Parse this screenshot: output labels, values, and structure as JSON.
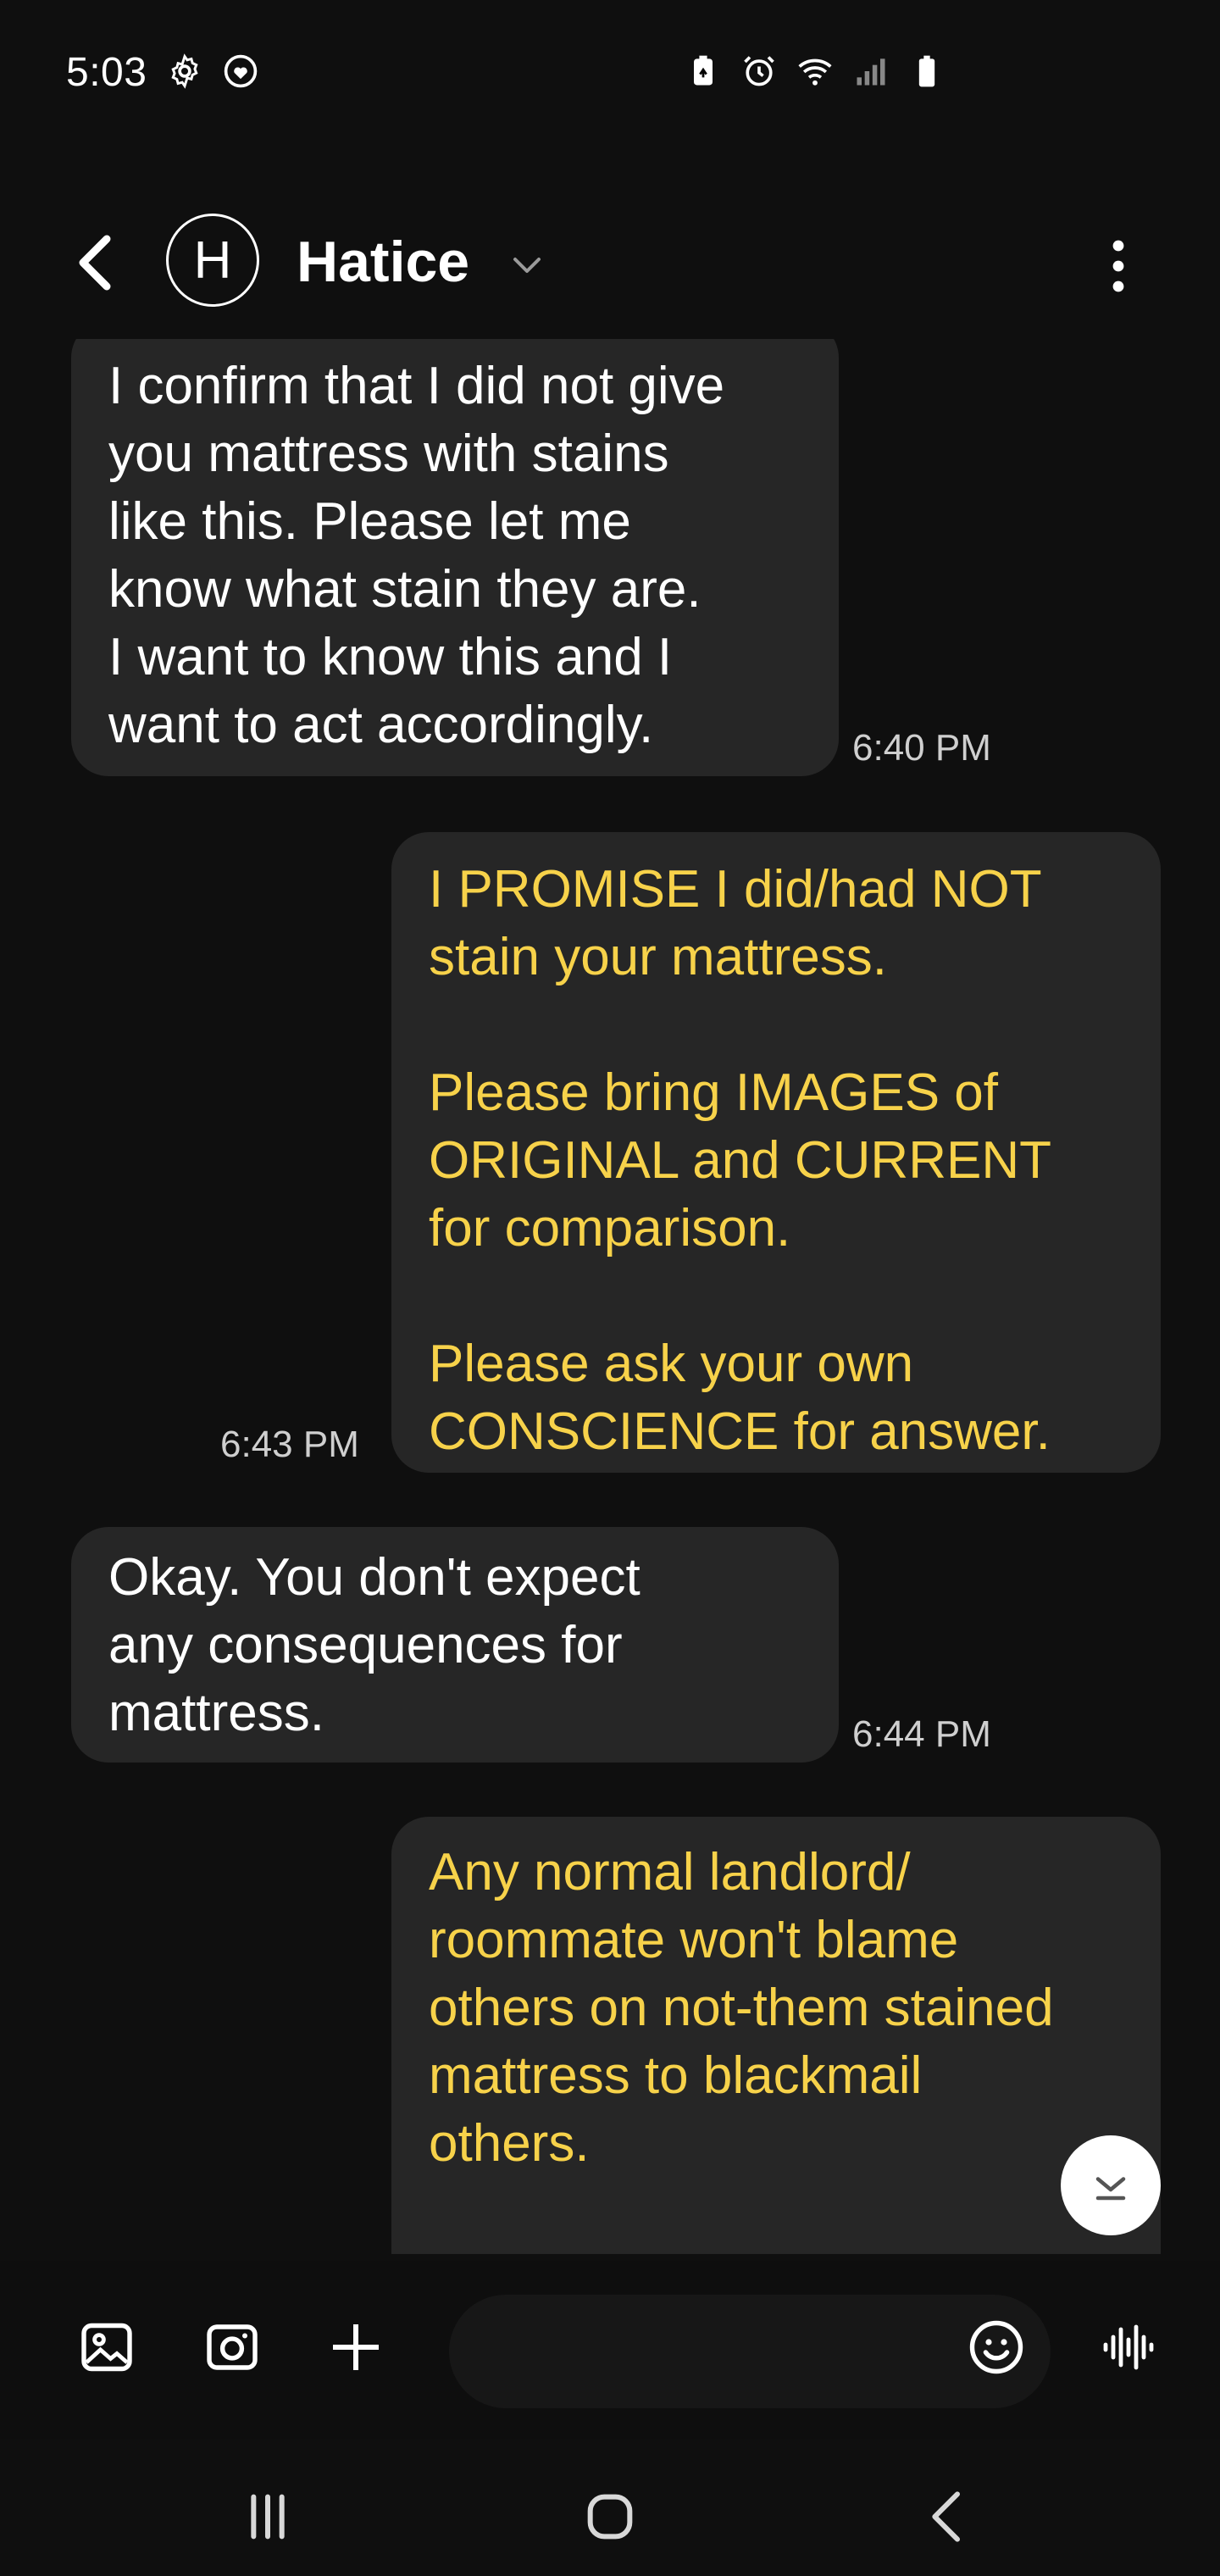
{
  "status_bar": {
    "time": "5:03",
    "left_icons": [
      "settings-gear-icon",
      "heart-status-icon"
    ],
    "right_icons": [
      "battery-saver-icon",
      "alarm-icon",
      "wifi-icon",
      "signal-icon",
      "battery-icon"
    ]
  },
  "header": {
    "avatar_letter": "H",
    "contact_name": "Hatice"
  },
  "messages": [
    {
      "direction": "incoming",
      "text": "I confirm that I did not give\nyou mattress with stains\nlike this. Please let me\nknow what stain they are.\nI want to know this and I\nwant to act accordingly.",
      "time": "6:40 PM"
    },
    {
      "direction": "outgoing",
      "text": "I PROMISE I did/had NOT\nstain your mattress.\n\nPlease bring IMAGES of\nORIGINAL and CURRENT\nfor comparison.\n\nPlease ask your own\nCONSCIENCE for answer.",
      "time": "6:43 PM"
    },
    {
      "direction": "incoming",
      "text": "Okay. You don't expect\nany consequences for\nmattress.",
      "time": "6:44 PM"
    },
    {
      "direction": "outgoing",
      "text": "Any normal landlord/\nroommate won't blame\nothers on not-them stained\nmattress to blackmail\nothers.\n\nThank you for at least\nr\nmattress finally as I have",
      "time": ""
    }
  ],
  "colors": {
    "background": "#0f0f0f",
    "bubble": "#262626",
    "incoming_text": "#ffffff",
    "outgoing_text": "#f7d24a",
    "timestamp": "#cfcfcf"
  },
  "composer": {
    "tools": [
      "gallery-icon",
      "camera-icon",
      "plus-icon"
    ],
    "emoji_icon": "emoji-icon",
    "voice_icon": "voice-wave-icon"
  },
  "nav_bar": [
    "recents-icon",
    "home-icon",
    "back-icon"
  ]
}
